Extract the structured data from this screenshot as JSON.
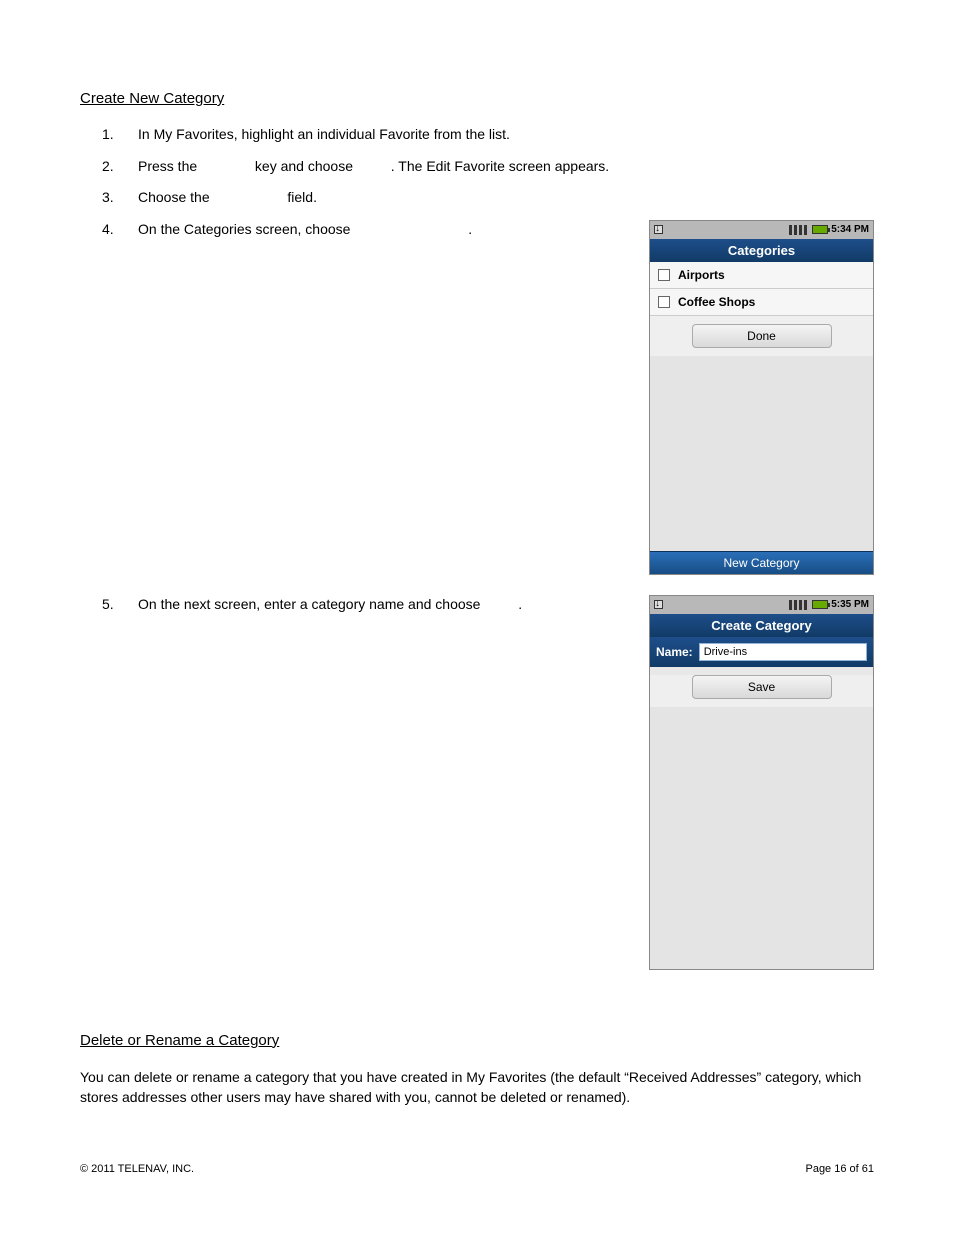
{
  "section1": {
    "heading": "Create New Category",
    "steps": {
      "s1": {
        "num": "1.",
        "text": "In My Favorites, highlight an individual Favorite from the list."
      },
      "s2": {
        "num": "2.",
        "a": "Press the ",
        "b": " key and choose ",
        "c": ". The Edit Favorite screen appears."
      },
      "s3": {
        "num": "3.",
        "a": "Choose the ",
        "b": " field."
      },
      "s4": {
        "num": "4.",
        "a": "On the Categories screen, choose ",
        "b": "."
      },
      "s5": {
        "num": "5.",
        "a": "On the next screen, enter a category name and choose ",
        "b": "."
      }
    }
  },
  "phone1": {
    "time": "5:34 PM",
    "title": "Categories",
    "items": [
      "Airports",
      "Coffee Shops"
    ],
    "done": "Done",
    "newcat": "New Category"
  },
  "phone2": {
    "time": "5:35 PM",
    "title": "Create Category",
    "nameLabel": "Name:",
    "nameValue": "Drive-ins",
    "save": "Save"
  },
  "section2": {
    "heading": "Delete or Rename a Category",
    "para": "You can delete or rename a category that you have created in My Favorites (the default “Received Addresses” category, which stores addresses other users may have shared with you, cannot be deleted or renamed)."
  },
  "footer": {
    "left": "© 2011 TELENAV, INC.",
    "right": "Page 16 of 61"
  }
}
